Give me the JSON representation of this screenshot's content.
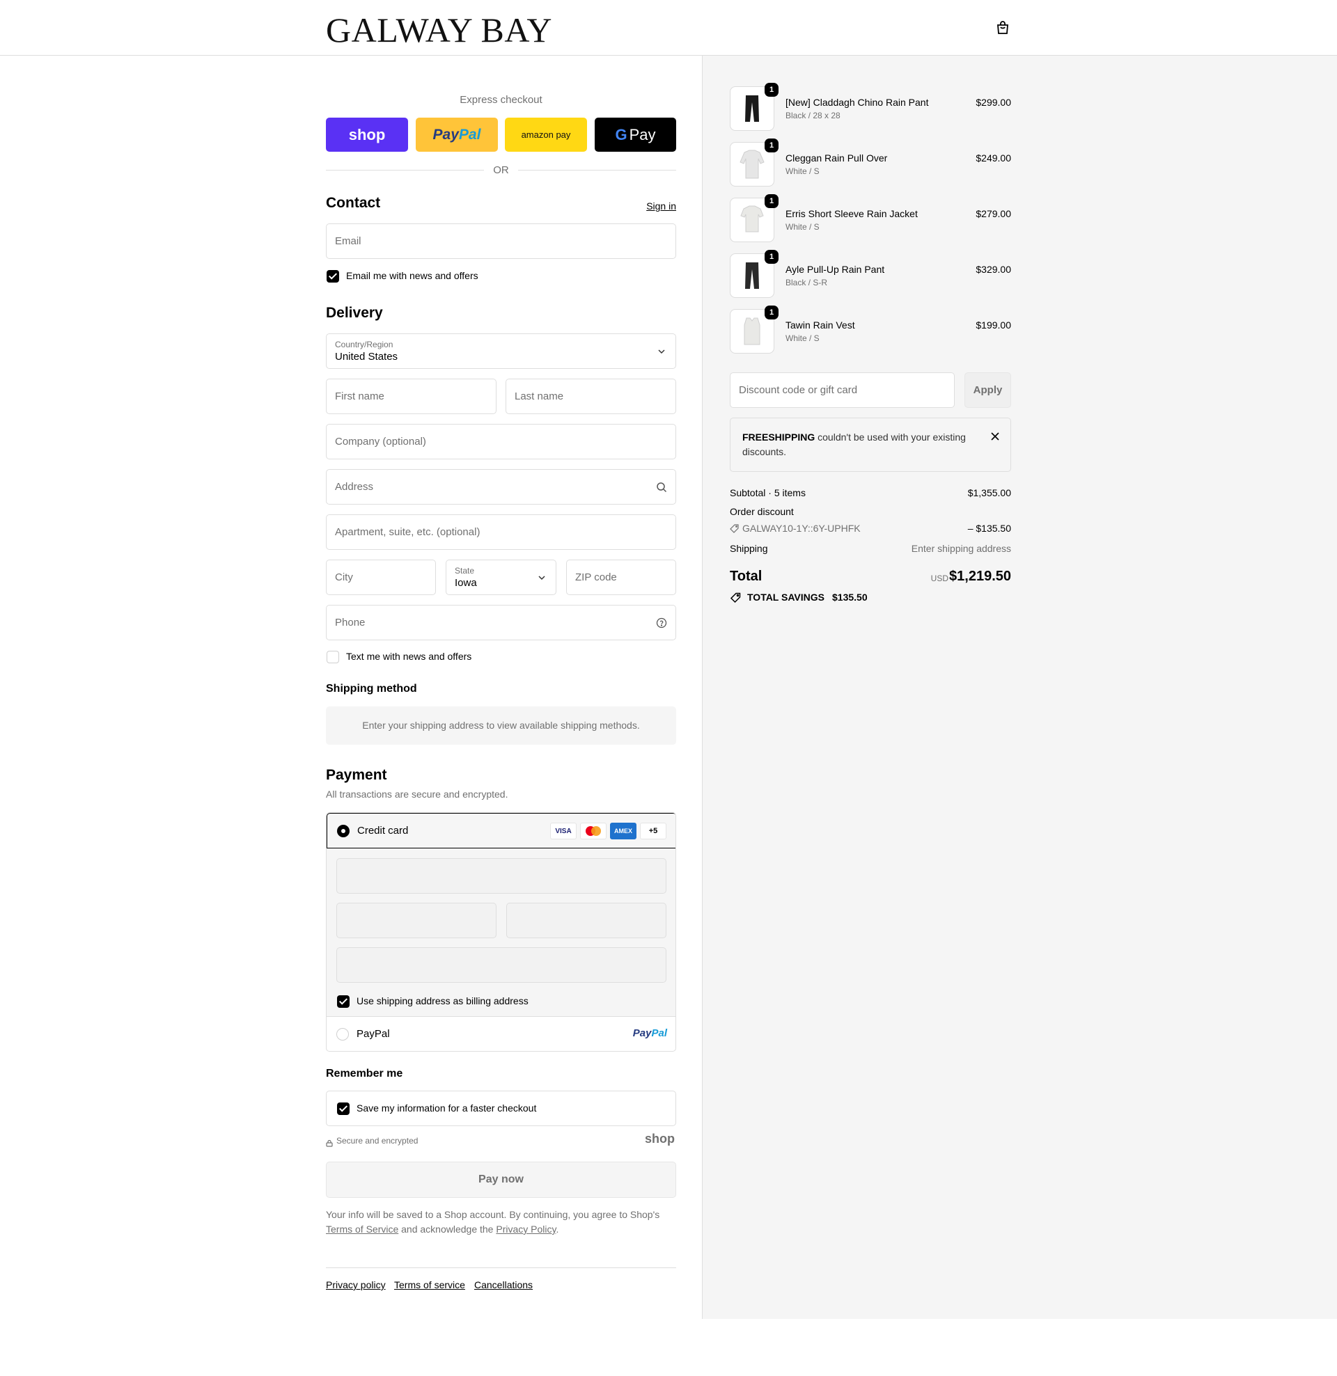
{
  "brand": {
    "logo_text": "GALWAY BAY"
  },
  "express": {
    "title": "Express checkout",
    "shop_label": "shop",
    "paypal_label_a": "Pay",
    "paypal_label_b": "Pal",
    "amazon_label": "amazon pay",
    "gpay_g": "G",
    "gpay_label": "Pay",
    "or_text": "OR"
  },
  "contact": {
    "heading": "Contact",
    "signin_label": "Sign in",
    "email_placeholder": "Email",
    "news_label": "Email me with news and offers",
    "news_checked": true
  },
  "delivery": {
    "heading": "Delivery",
    "country_label": "Country/Region",
    "country_value": "United States",
    "first_name_placeholder": "First name",
    "last_name_placeholder": "Last name",
    "company_placeholder": "Company (optional)",
    "address_placeholder": "Address",
    "apartment_placeholder": "Apartment, suite, etc. (optional)",
    "city_placeholder": "City",
    "state_label": "State",
    "state_value": "Iowa",
    "zip_placeholder": "ZIP code",
    "phone_placeholder": "Phone",
    "text_label": "Text me with news and offers",
    "text_checked": false
  },
  "shipping": {
    "heading": "Shipping method",
    "message": "Enter your shipping address to view available shipping methods."
  },
  "payment": {
    "heading": "Payment",
    "subtitle": "All transactions are secure and encrypted.",
    "credit_card_label": "Credit card",
    "card_brands": [
      "VISA",
      "Mastercard",
      "AMEX"
    ],
    "more_cards": "+5",
    "billing_label": "Use shipping address as billing address",
    "billing_checked": true,
    "paypal_option_label": "PayPal",
    "paypal_logo_a": "Pay",
    "paypal_logo_b": "Pal"
  },
  "remember": {
    "heading": "Remember me",
    "save_label": "Save my information for a faster checkout",
    "save_checked": true,
    "secure_label": "Secure and encrypted",
    "shop_logo": "shop"
  },
  "pay_now_label": "Pay now",
  "legal": {
    "text_a": "Your info will be saved to a Shop account. By continuing, you agree to Shop's ",
    "terms": "Terms of Service",
    "text_b": " and acknowledge the ",
    "privacy": "Privacy Policy",
    "text_c": "."
  },
  "footer": {
    "links": [
      "Privacy policy",
      "Terms of service",
      "Cancellations"
    ]
  },
  "summary": {
    "items": [
      {
        "name": "[New] Claddagh Chino Rain Pant",
        "variant": "Black / 28 x 28",
        "price": "$299.00",
        "qty": "1",
        "image": "dark-pant"
      },
      {
        "name": "Cleggan Rain Pull Over",
        "variant": "White / S",
        "price": "$249.00",
        "qty": "1",
        "image": "white-pullover"
      },
      {
        "name": "Erris Short Sleeve Rain Jacket",
        "variant": "White / S",
        "price": "$279.00",
        "qty": "1",
        "image": "white-jacket"
      },
      {
        "name": "Ayle Pull-Up Rain Pant",
        "variant": "Black / S-R",
        "price": "$329.00",
        "qty": "1",
        "image": "dark-pant"
      },
      {
        "name": "Tawin Rain Vest",
        "variant": "White / S",
        "price": "$199.00",
        "qty": "1",
        "image": "white-vest"
      }
    ],
    "discount_placeholder": "Discount code or gift card",
    "apply_label": "Apply",
    "notice_code": "FREESHIPPING",
    "notice_text": " couldn't be used with your existing discounts.",
    "subtotal_label": "Subtotal · 5 items",
    "subtotal_value": "$1,355.00",
    "order_discount_label": "Order discount",
    "discount_code": "GALWAY10-1Y::6Y-UPHFK",
    "discount_value": "– $135.50",
    "shipping_label": "Shipping",
    "shipping_value": "Enter shipping address",
    "total_label": "Total",
    "currency": "USD",
    "total_value": "$1,219.50",
    "savings_label": "TOTAL SAVINGS",
    "savings_value": "$135.50"
  }
}
